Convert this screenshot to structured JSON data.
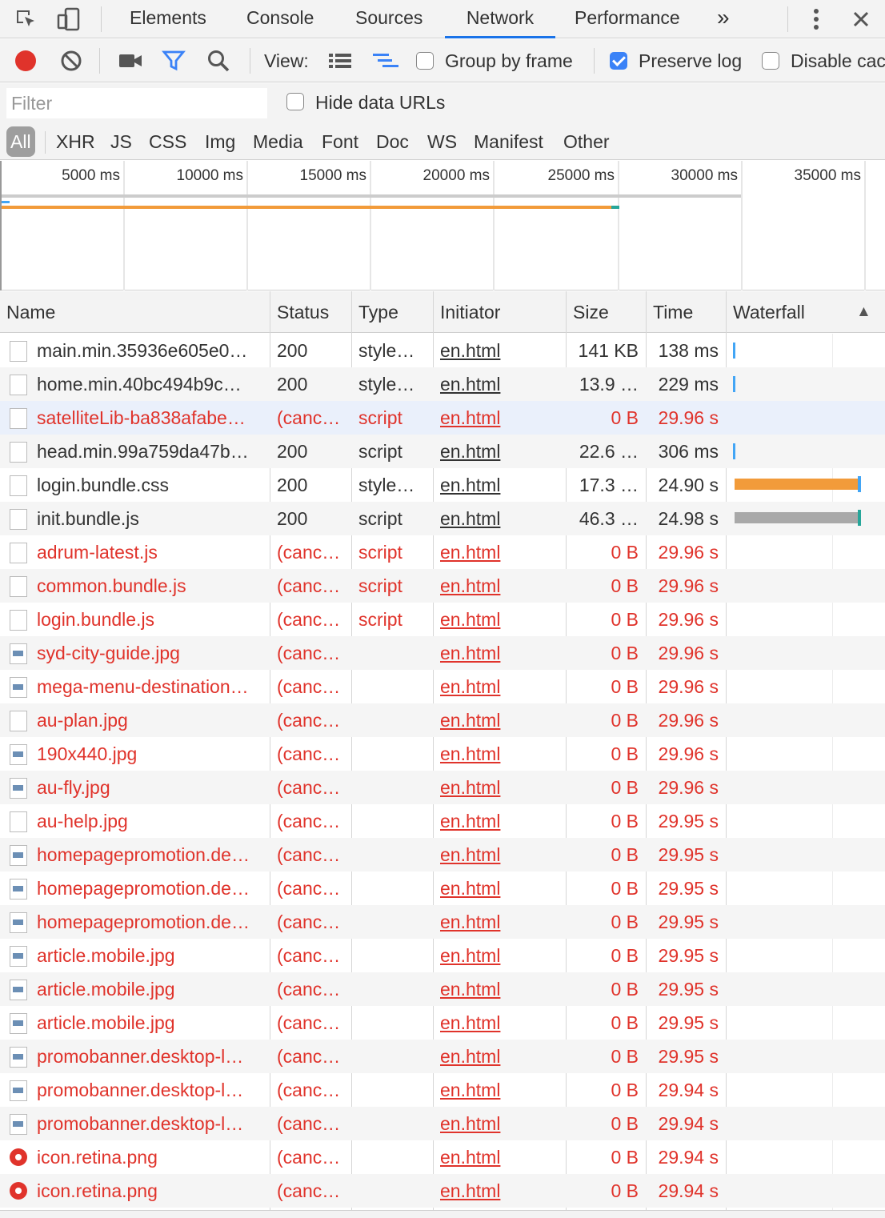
{
  "tabbar": {
    "tabs": [
      "Elements",
      "Console",
      "Sources",
      "Network",
      "Performance"
    ],
    "active_tab": "Network",
    "more": "»"
  },
  "toolbar": {
    "view_label": "View:",
    "group_by_frame": "Group by frame",
    "preserve_log": "Preserve log",
    "disable_cache": "Disable cac",
    "preserve_log_checked": true,
    "group_by_frame_checked": false,
    "disable_cache_checked": false
  },
  "filter": {
    "placeholder": "Filter",
    "hide_data_urls": "Hide data URLs"
  },
  "types": [
    "All",
    "XHR",
    "JS",
    "CSS",
    "Img",
    "Media",
    "Font",
    "Doc",
    "WS",
    "Manifest",
    "Other"
  ],
  "overview": {
    "ticks": [
      "5000 ms",
      "10000 ms",
      "15000 ms",
      "20000 ms",
      "25000 ms",
      "30000 ms",
      "35000 ms"
    ]
  },
  "columns": {
    "name": "Name",
    "status": "Status",
    "type": "Type",
    "initiator": "Initiator",
    "size": "Size",
    "time": "Time",
    "waterfall": "Waterfall",
    "sort_indicator": "▲"
  },
  "colors": {
    "error": "#e0332b",
    "bar_orange": "#f29b3a",
    "bar_gray": "#a9a9a9",
    "bar_blue": "#42a5f5",
    "accent": "#1a73e8"
  },
  "rows": [
    {
      "name": "main.min.35936e605e0…",
      "status": "200",
      "type": "style…",
      "initiator": "en.html",
      "size": "141 KB",
      "time": "138 ms",
      "error": false,
      "icon": "file-icon",
      "waterfall": "blue-tick"
    },
    {
      "name": "home.min.40bc494b9c…",
      "status": "200",
      "type": "style…",
      "initiator": "en.html",
      "size": "13.9 …",
      "time": "229 ms",
      "error": false,
      "icon": "file-icon",
      "waterfall": "blue-tick"
    },
    {
      "name": "satelliteLib-ba838afabe…",
      "status": "(canc…",
      "type": "script",
      "initiator": "en.html",
      "size": "0 B",
      "time": "29.96 s",
      "error": true,
      "icon": "file-icon",
      "waterfall": "none"
    },
    {
      "name": "head.min.99a759da47b…",
      "status": "200",
      "type": "script",
      "initiator": "en.html",
      "size": "22.6 …",
      "time": "306 ms",
      "error": false,
      "icon": "file-icon",
      "waterfall": "blue-tick"
    },
    {
      "name": "login.bundle.css",
      "status": "200",
      "type": "style…",
      "initiator": "en.html",
      "size": "17.3 …",
      "time": "24.90 s",
      "error": false,
      "icon": "file-icon",
      "waterfall": "orange-bar"
    },
    {
      "name": "init.bundle.js",
      "status": "200",
      "type": "script",
      "initiator": "en.html",
      "size": "46.3 …",
      "time": "24.98 s",
      "error": false,
      "icon": "file-icon",
      "waterfall": "gray-bar"
    },
    {
      "name": "adrum-latest.js",
      "status": "(canc…",
      "type": "script",
      "initiator": "en.html",
      "size": "0 B",
      "time": "29.96 s",
      "error": true,
      "icon": "file-icon",
      "waterfall": "none"
    },
    {
      "name": "common.bundle.js",
      "status": "(canc…",
      "type": "script",
      "initiator": "en.html",
      "size": "0 B",
      "time": "29.96 s",
      "error": true,
      "icon": "file-icon",
      "waterfall": "none"
    },
    {
      "name": "login.bundle.js",
      "status": "(canc…",
      "type": "script",
      "initiator": "en.html",
      "size": "0 B",
      "time": "29.96 s",
      "error": true,
      "icon": "file-icon",
      "waterfall": "none"
    },
    {
      "name": "syd-city-guide.jpg",
      "status": "(canc…",
      "type": "",
      "initiator": "en.html",
      "size": "0 B",
      "time": "29.96 s",
      "error": true,
      "icon": "image-icon",
      "waterfall": "none"
    },
    {
      "name": "mega-menu-destination…",
      "status": "(canc…",
      "type": "",
      "initiator": "en.html",
      "size": "0 B",
      "time": "29.96 s",
      "error": true,
      "icon": "image-icon",
      "waterfall": "none"
    },
    {
      "name": "au-plan.jpg",
      "status": "(canc…",
      "type": "",
      "initiator": "en.html",
      "size": "0 B",
      "time": "29.96 s",
      "error": true,
      "icon": "file-icon",
      "waterfall": "none"
    },
    {
      "name": "190x440.jpg",
      "status": "(canc…",
      "type": "",
      "initiator": "en.html",
      "size": "0 B",
      "time": "29.96 s",
      "error": true,
      "icon": "image-icon",
      "waterfall": "none"
    },
    {
      "name": "au-fly.jpg",
      "status": "(canc…",
      "type": "",
      "initiator": "en.html",
      "size": "0 B",
      "time": "29.96 s",
      "error": true,
      "icon": "image-icon",
      "waterfall": "none"
    },
    {
      "name": "au-help.jpg",
      "status": "(canc…",
      "type": "",
      "initiator": "en.html",
      "size": "0 B",
      "time": "29.95 s",
      "error": true,
      "icon": "file-icon",
      "waterfall": "none"
    },
    {
      "name": "homepagepromotion.de…",
      "status": "(canc…",
      "type": "",
      "initiator": "en.html",
      "size": "0 B",
      "time": "29.95 s",
      "error": true,
      "icon": "image-icon",
      "waterfall": "none"
    },
    {
      "name": "homepagepromotion.de…",
      "status": "(canc…",
      "type": "",
      "initiator": "en.html",
      "size": "0 B",
      "time": "29.95 s",
      "error": true,
      "icon": "image-icon",
      "waterfall": "none"
    },
    {
      "name": "homepagepromotion.de…",
      "status": "(canc…",
      "type": "",
      "initiator": "en.html",
      "size": "0 B",
      "time": "29.95 s",
      "error": true,
      "icon": "image-icon",
      "waterfall": "none"
    },
    {
      "name": "article.mobile.jpg",
      "status": "(canc…",
      "type": "",
      "initiator": "en.html",
      "size": "0 B",
      "time": "29.95 s",
      "error": true,
      "icon": "image-icon",
      "waterfall": "none"
    },
    {
      "name": "article.mobile.jpg",
      "status": "(canc…",
      "type": "",
      "initiator": "en.html",
      "size": "0 B",
      "time": "29.95 s",
      "error": true,
      "icon": "image-icon",
      "waterfall": "none"
    },
    {
      "name": "article.mobile.jpg",
      "status": "(canc…",
      "type": "",
      "initiator": "en.html",
      "size": "0 B",
      "time": "29.95 s",
      "error": true,
      "icon": "image-icon",
      "waterfall": "none"
    },
    {
      "name": "promobanner.desktop-l…",
      "status": "(canc…",
      "type": "",
      "initiator": "en.html",
      "size": "0 B",
      "time": "29.95 s",
      "error": true,
      "icon": "image-icon",
      "waterfall": "none"
    },
    {
      "name": "promobanner.desktop-l…",
      "status": "(canc…",
      "type": "",
      "initiator": "en.html",
      "size": "0 B",
      "time": "29.94 s",
      "error": true,
      "icon": "image-icon",
      "waterfall": "none"
    },
    {
      "name": "promobanner.desktop-l…",
      "status": "(canc…",
      "type": "",
      "initiator": "en.html",
      "size": "0 B",
      "time": "29.94 s",
      "error": true,
      "icon": "image-icon",
      "waterfall": "none"
    },
    {
      "name": "icon.retina.png",
      "status": "(canc…",
      "type": "",
      "initiator": "en.html",
      "size": "0 B",
      "time": "29.94 s",
      "error": true,
      "icon": "red-circle-icon",
      "waterfall": "none"
    },
    {
      "name": "icon.retina.png",
      "status": "(canc…",
      "type": "",
      "initiator": "en.html",
      "size": "0 B",
      "time": "29.94 s",
      "error": true,
      "icon": "red-circle-icon",
      "waterfall": "none"
    }
  ]
}
